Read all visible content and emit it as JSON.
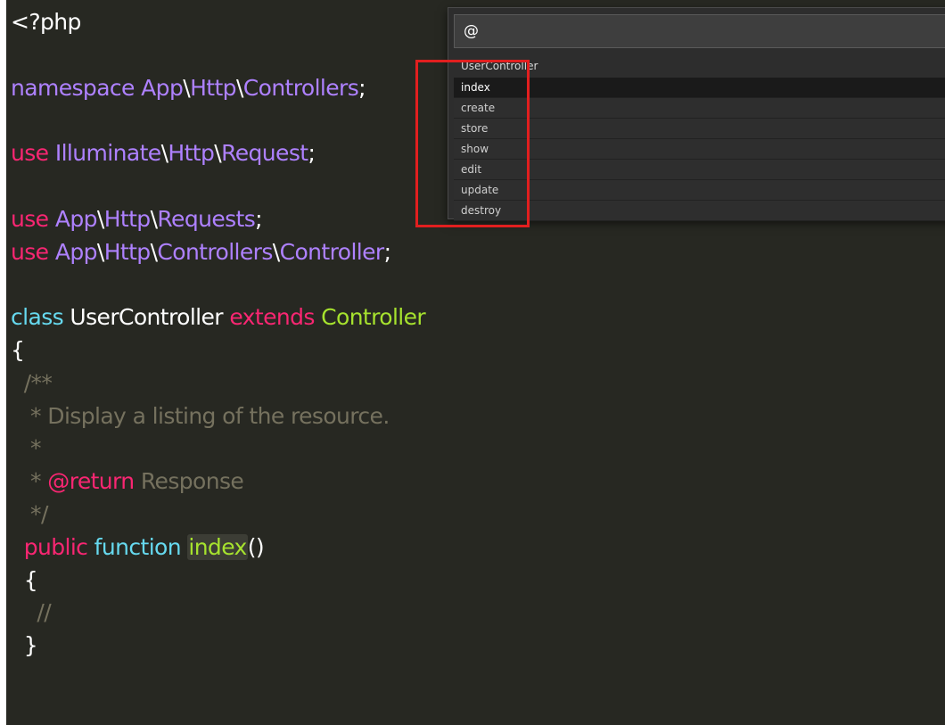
{
  "colors": {
    "background": "#272822",
    "plain": "#ffffff",
    "keyword": "#f92672",
    "namespace": "#ae81ff",
    "storage_type": "#66d9ef",
    "inherited_class": "#a6e22e",
    "function_name": "#a6e22e",
    "comment": "#75715e",
    "annotation_highlight": "#e21f1f"
  },
  "code_lines": [
    [
      {
        "t": "<?php",
        "c": "plain"
      }
    ],
    [],
    [
      {
        "t": "namespace App",
        "c": "namespace"
      },
      {
        "t": "\\",
        "c": "plain"
      },
      {
        "t": "Http",
        "c": "namespace"
      },
      {
        "t": "\\",
        "c": "plain"
      },
      {
        "t": "Controllers",
        "c": "namespace"
      },
      {
        "t": ";",
        "c": "plain"
      }
    ],
    [],
    [
      {
        "t": "use ",
        "c": "keyword"
      },
      {
        "t": "Illuminate",
        "c": "namespace"
      },
      {
        "t": "\\",
        "c": "plain"
      },
      {
        "t": "Http",
        "c": "namespace"
      },
      {
        "t": "\\",
        "c": "plain"
      },
      {
        "t": "Request",
        "c": "namespace"
      },
      {
        "t": ";",
        "c": "plain"
      }
    ],
    [],
    [
      {
        "t": "use ",
        "c": "keyword"
      },
      {
        "t": "App",
        "c": "namespace"
      },
      {
        "t": "\\",
        "c": "plain"
      },
      {
        "t": "Http",
        "c": "namespace"
      },
      {
        "t": "\\",
        "c": "plain"
      },
      {
        "t": "Requests",
        "c": "namespace"
      },
      {
        "t": ";",
        "c": "plain"
      }
    ],
    [
      {
        "t": "use ",
        "c": "keyword"
      },
      {
        "t": "App",
        "c": "namespace"
      },
      {
        "t": "\\",
        "c": "plain"
      },
      {
        "t": "Http",
        "c": "namespace"
      },
      {
        "t": "\\",
        "c": "plain"
      },
      {
        "t": "Controllers",
        "c": "namespace"
      },
      {
        "t": "\\",
        "c": "plain"
      },
      {
        "t": "Controller",
        "c": "namespace"
      },
      {
        "t": ";",
        "c": "plain"
      }
    ],
    [],
    [
      {
        "t": "class ",
        "c": "storage_type"
      },
      {
        "t": "UserController ",
        "c": "plain"
      },
      {
        "t": "extends ",
        "c": "keyword"
      },
      {
        "t": "Controller",
        "c": "inherited_class"
      }
    ],
    [
      {
        "t": "{",
        "c": "plain"
      }
    ],
    [
      {
        "t": "  /**",
        "c": "comment"
      }
    ],
    [
      {
        "t": "   * Display a listing of the resource.",
        "c": "comment"
      }
    ],
    [
      {
        "t": "   *",
        "c": "comment"
      }
    ],
    [
      {
        "t": "   * ",
        "c": "comment"
      },
      {
        "t": "@return",
        "c": "keyword"
      },
      {
        "t": " Response",
        "c": "comment"
      }
    ],
    [
      {
        "t": "   */",
        "c": "comment"
      }
    ],
    [
      {
        "t": "  ",
        "c": "plain"
      },
      {
        "t": "public ",
        "c": "keyword"
      },
      {
        "t": "function ",
        "c": "storage_type"
      },
      {
        "t": "index",
        "c": "function_name",
        "hl": true
      },
      {
        "t": "()",
        "c": "plain"
      }
    ],
    [
      {
        "t": "  {",
        "c": "plain"
      }
    ],
    [
      {
        "t": "    //",
        "c": "comment"
      }
    ],
    [
      {
        "t": "  }",
        "c": "plain"
      }
    ]
  ],
  "palette": {
    "query": "@",
    "group_header": "UserController",
    "items": [
      {
        "label": "index",
        "selected": true
      },
      {
        "label": "create",
        "selected": false
      },
      {
        "label": "store",
        "selected": false
      },
      {
        "label": "show",
        "selected": false
      },
      {
        "label": "edit",
        "selected": false
      },
      {
        "label": "update",
        "selected": false
      },
      {
        "label": "destroy",
        "selected": false
      }
    ]
  }
}
